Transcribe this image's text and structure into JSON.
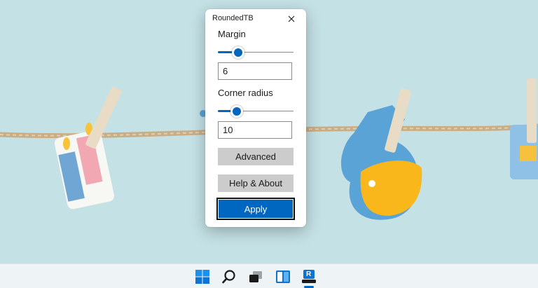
{
  "window": {
    "title": "RoundedTB",
    "margin": {
      "label": "Margin",
      "value": "6",
      "slider_fraction": 0.27
    },
    "corner_radius": {
      "label": "Corner radius",
      "value": "10",
      "slider_fraction": 0.25
    },
    "buttons": {
      "advanced": "Advanced",
      "help_about": "Help & About",
      "apply": "Apply"
    }
  },
  "taskbar": {
    "icons": [
      "windows-start-icon",
      "search-icon",
      "task-view-icon",
      "widgets-icon",
      "roundedtb-app-icon"
    ],
    "app_letter": "R"
  },
  "colors": {
    "accent": "#0067c0",
    "wallpaper": "#c4e1e5",
    "taskbar": "#eef3f6"
  }
}
